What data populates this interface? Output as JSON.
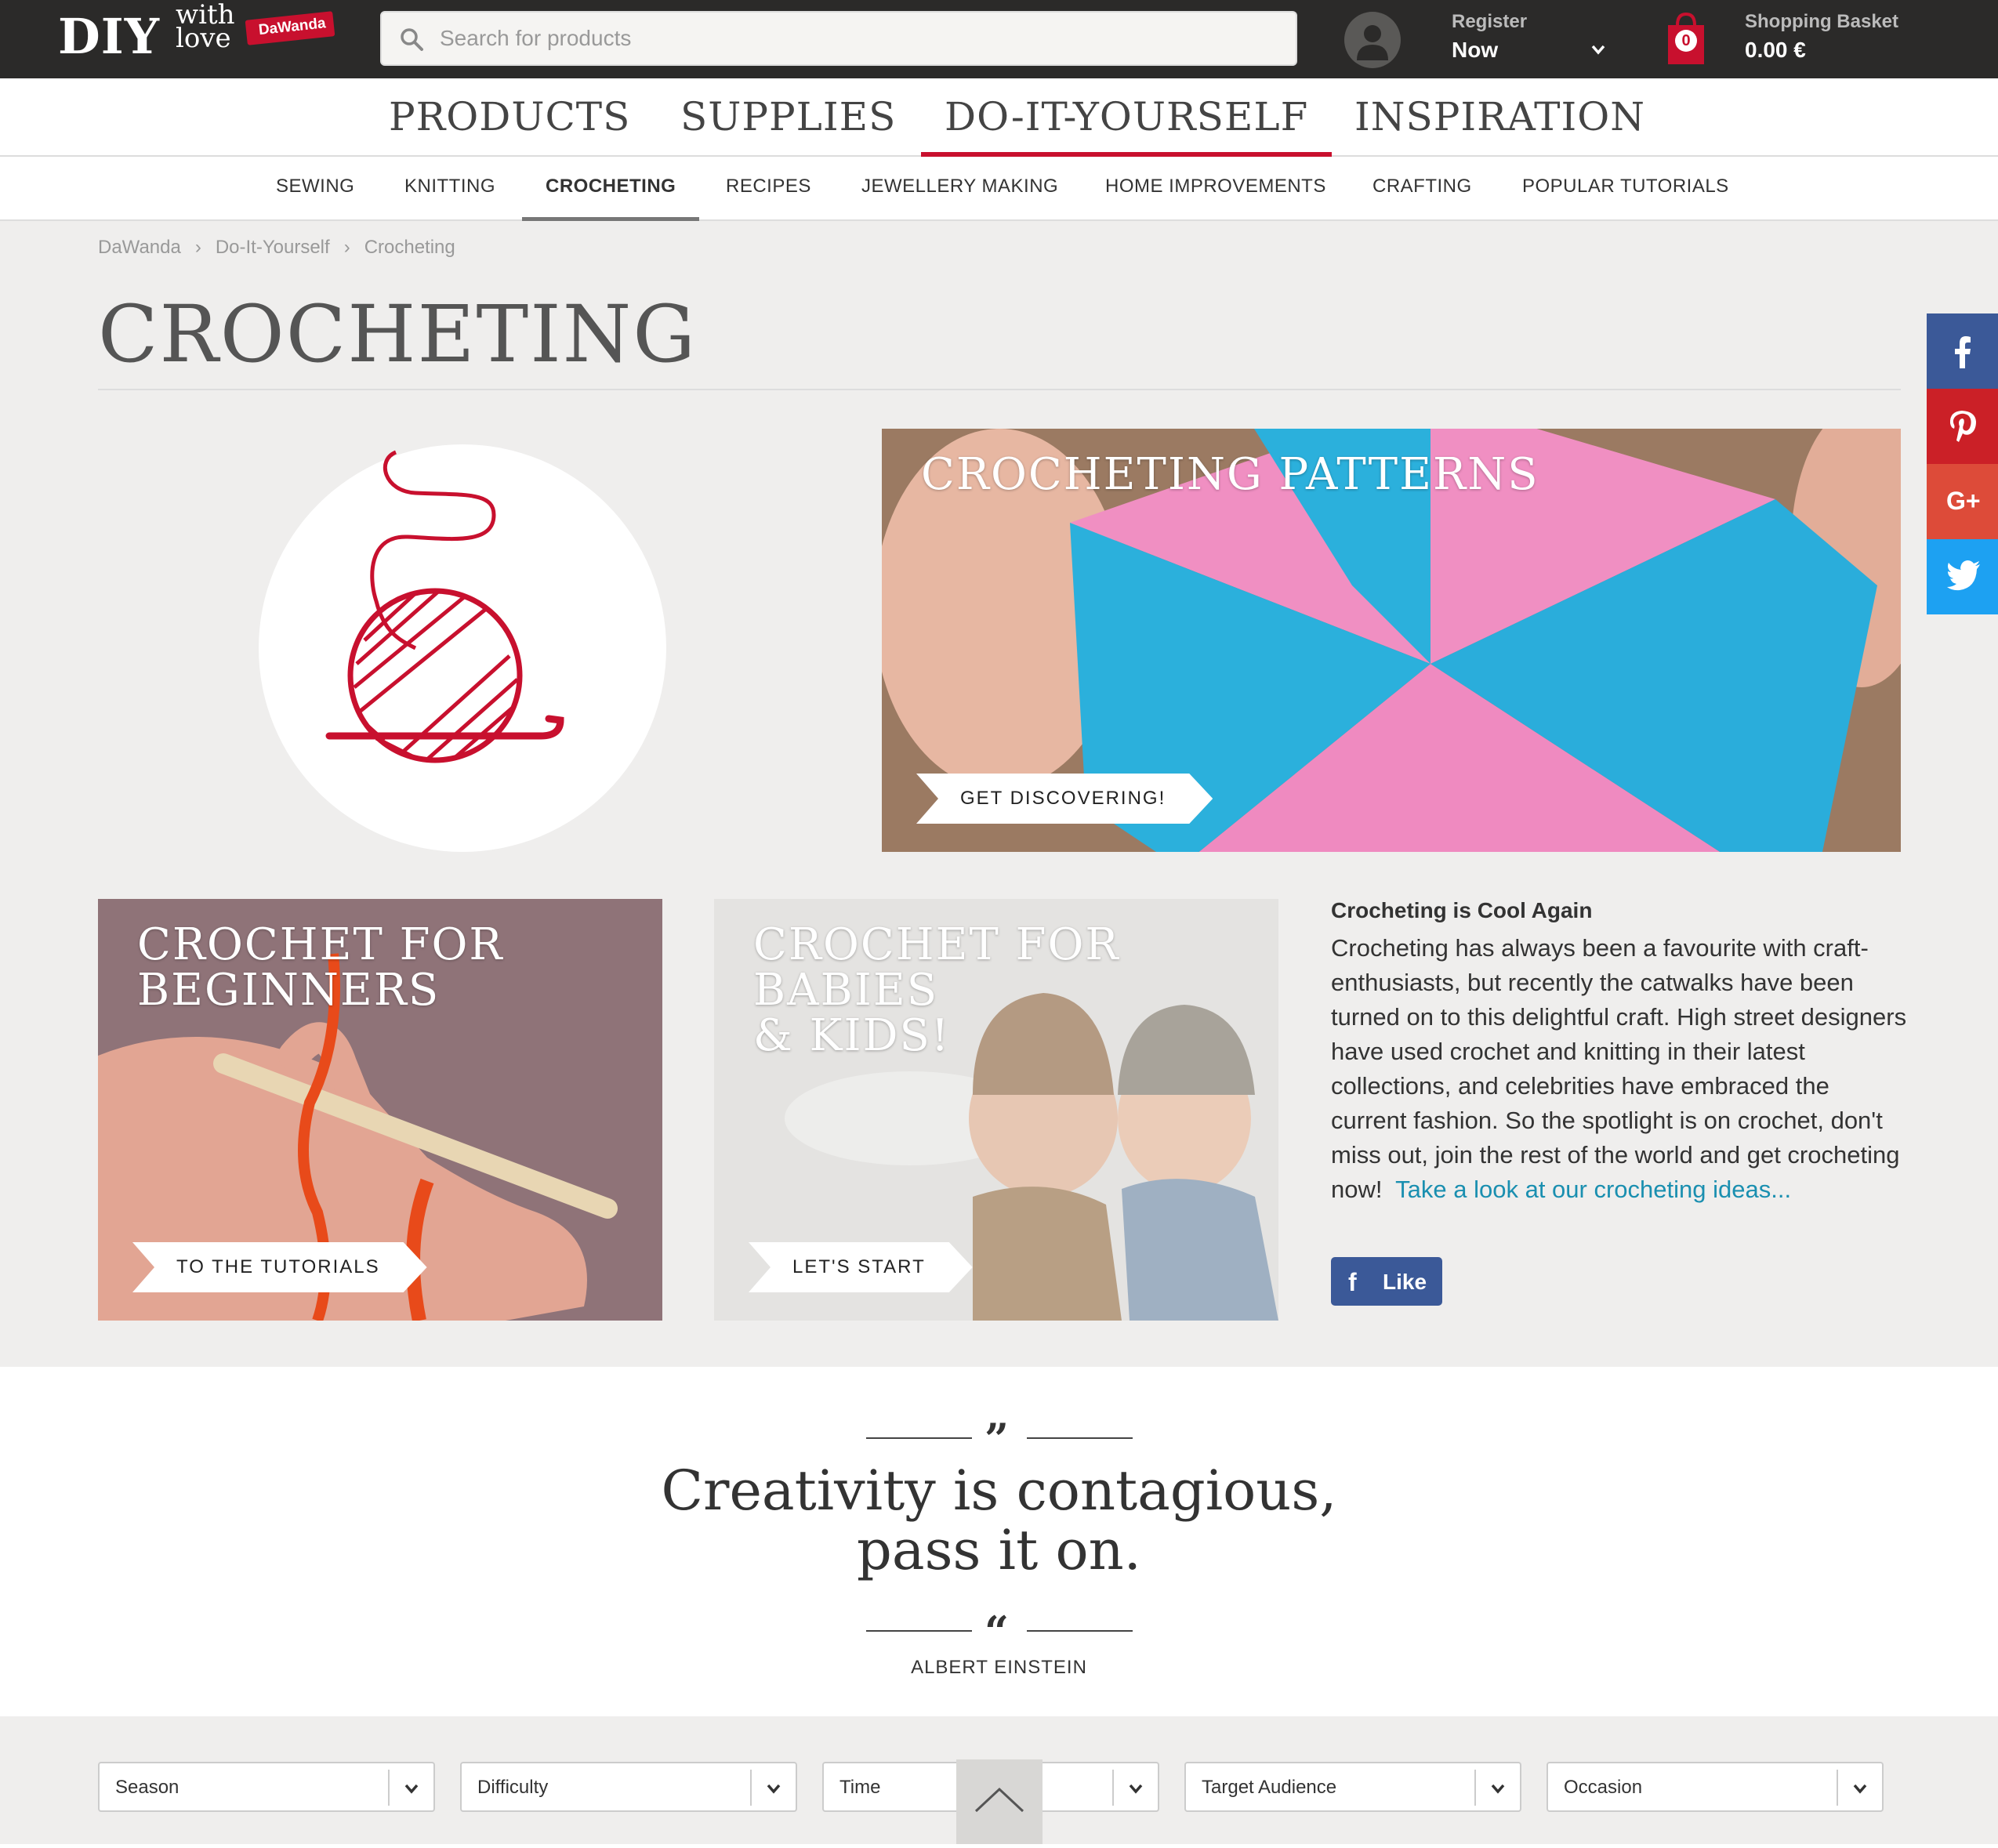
{
  "header": {
    "logo": {
      "main": "DIY",
      "with": "with",
      "love": "love",
      "tag": "DaWanda"
    },
    "search_placeholder": "Search for products",
    "register": {
      "line1": "Register",
      "line2": "Now"
    },
    "basket": {
      "count": "0",
      "line1": "Shopping Basket",
      "line2": "0.00 €"
    }
  },
  "main_nav": [
    "PRODUCTS",
    "SUPPLIES",
    "DO-IT-YOURSELF",
    "INSPIRATION"
  ],
  "sub_nav": [
    "SEWING",
    "KNITTING",
    "CROCHETING",
    "RECIPES",
    "JEWELLERY MAKING",
    "HOME IMPROVEMENTS",
    "CRAFTING",
    "POPULAR TUTORIALS"
  ],
  "breadcrumb": [
    "DaWanda",
    "Do-It-Yourself",
    "Crocheting"
  ],
  "page_title": "CROCHETING",
  "tiles": {
    "patterns": {
      "title": "CROCHETING PATTERNS",
      "button": "GET DISCOVERING!"
    },
    "beginners": {
      "title_l1": "CROCHET FOR",
      "title_l2": "BEGINNERS",
      "button": "TO THE TUTORIALS"
    },
    "babies": {
      "title_l1": "CROCHET FOR BABIES",
      "title_l2": "& KIDS!",
      "button": "LET'S START"
    }
  },
  "article": {
    "heading": "Crocheting is Cool Again",
    "body": "Crocheting has always been a favourite with craft-enthusiasts, but recently the catwalks have been turned on to this delightful craft. High street designers have used crochet and knitting in their latest collections, and celebrities have embraced the current fashion. So the spotlight is on crochet, don't miss out, join the rest of the world and get crocheting now!",
    "link": "Take a look at our crocheting ideas...",
    "like": "Like"
  },
  "quote": {
    "open_mark": "”",
    "close_mark": "“",
    "line1": "Creativity is contagious,",
    "line2": "pass it on.",
    "author": "ALBERT EINSTEIN"
  },
  "filters": [
    "Season",
    "Difficulty",
    "Time",
    "Target Audience",
    "Occasion"
  ],
  "colors": {
    "brand_red": "#c8102e",
    "topbar": "#2b2a29",
    "link": "#1a8fb0",
    "facebook": "#3b5998",
    "pinterest": "#cb2027",
    "googleplus": "#dd4b39",
    "twitter": "#1da1f2"
  },
  "social": [
    "facebook-icon",
    "pinterest-icon",
    "google-plus-icon",
    "twitter-icon"
  ]
}
